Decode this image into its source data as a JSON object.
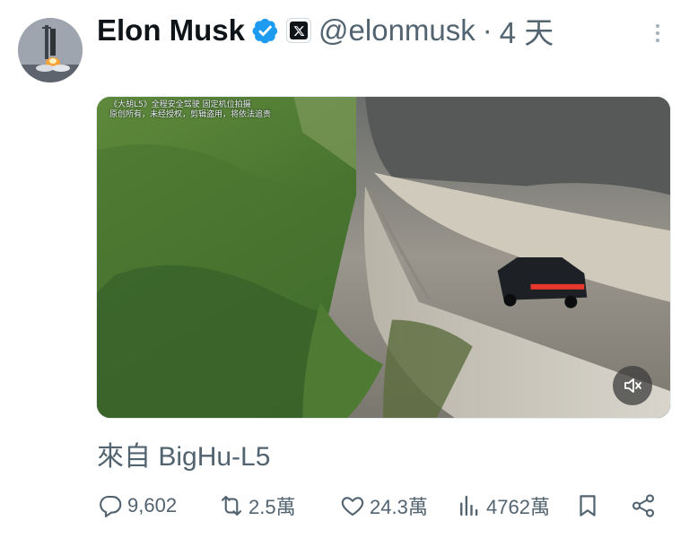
{
  "tweet": {
    "author": {
      "name": "Elon Musk",
      "handle": "@elonmusk",
      "separator": "·",
      "time": "4 天",
      "verified": true,
      "avatar_icon": "rocket-launch-icon"
    },
    "media": {
      "watermark_line1": "《大胡L5》全程安全驾驶 固定机位拍摄",
      "watermark_line2": "原创所有，未经授权，剪辑盗用，将依法追责",
      "mute_icon": "speaker-muted-icon"
    },
    "caption": "來自 BigHu-L5",
    "stats": {
      "replies": "9,602",
      "reposts": "2.5萬",
      "likes": "24.3萬",
      "views": "4762萬"
    },
    "colors": {
      "verified_blue": "#1d9bf0",
      "text_primary": "#0f1419",
      "text_secondary": "#536471"
    }
  }
}
